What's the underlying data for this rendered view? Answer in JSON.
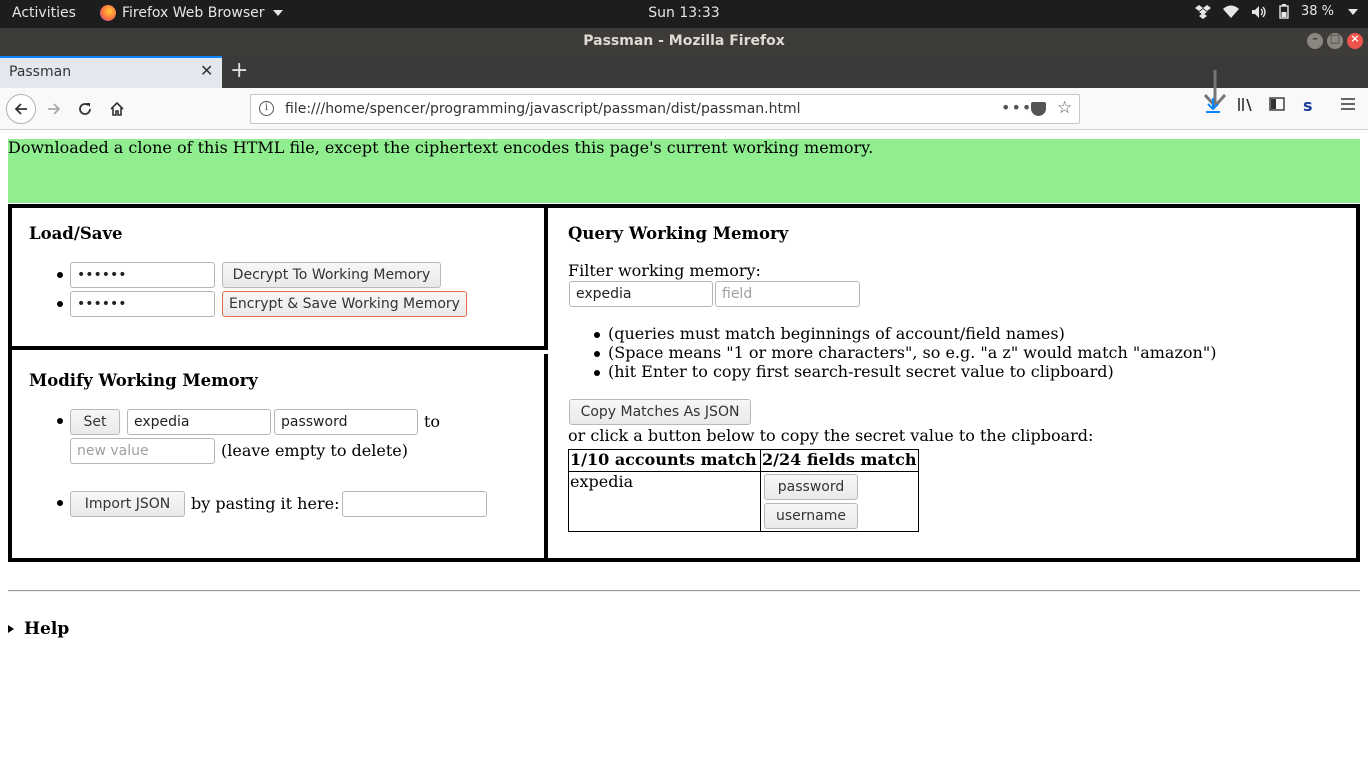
{
  "system_bar": {
    "activities": "Activities",
    "app_name": "Firefox Web Browser",
    "clock": "Sun 13:33",
    "battery": "38 %"
  },
  "window": {
    "title": "Passman - Mozilla Firefox"
  },
  "tabs": [
    {
      "label": "Passman",
      "active": true
    }
  ],
  "address_bar": {
    "url": "file:///home/spencer/programming/javascript/passman/dist/passman.html",
    "more": "•••"
  },
  "notice": {
    "text": "Downloaded a clone of this HTML file, except the ciphertext encodes this page's current working memory.",
    "background": "#90ee90"
  },
  "load_save": {
    "heading": "Load/Save",
    "decrypt_password": "••••••",
    "decrypt_button": "Decrypt To Working Memory",
    "encrypt_password": "••••••",
    "encrypt_button": "Encrypt & Save Working Memory"
  },
  "modify": {
    "heading": "Modify Working Memory",
    "set_button": "Set",
    "account_value": "expedia",
    "field_value": "password",
    "to_text": "to",
    "new_value_placeholder": "new value",
    "leave_empty_text": "(leave empty to delete)",
    "import_button": "Import JSON",
    "pasting_text": "by pasting it here:",
    "paste_value": ""
  },
  "query": {
    "heading": "Query Working Memory",
    "filter_label": "Filter working memory:",
    "account_filter": "expedia",
    "field_placeholder": "field",
    "notes": [
      "(queries must match beginnings of account/field names)",
      "(Space means \"1 or more characters\", so e.g. \"a z\" would match \"amazon\")",
      "(hit Enter to copy first search-result secret value to clipboard)"
    ],
    "copy_json_button": "Copy Matches As JSON",
    "click_hint": "or click a button below to copy the secret value to the clipboard:",
    "table": {
      "accounts_header": "1/10 accounts match",
      "fields_header": "2/24 fields match",
      "rows": [
        {
          "account": "expedia",
          "fields": [
            "password",
            "username"
          ]
        }
      ]
    }
  },
  "help": {
    "label": "Help"
  }
}
